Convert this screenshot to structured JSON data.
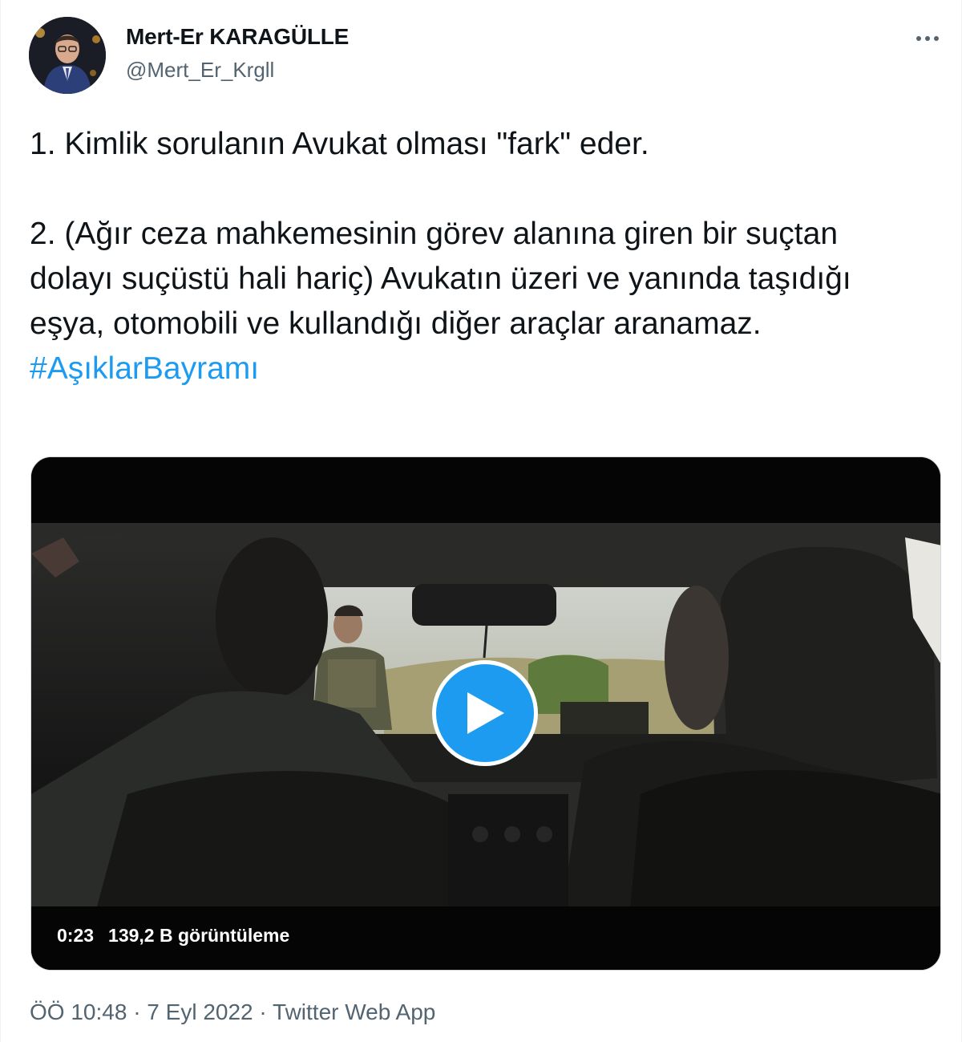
{
  "author": {
    "display_name": "Mert-Er KARAGÜLLE",
    "handle": "@Mert_Er_Krgll"
  },
  "tweet": {
    "line1": "1. Kimlik sorulanın Avukat olması \"fark\" eder.",
    "line2": "2. (Ağır ceza mahkemesinin görev alanına giren bir suçtan dolayı suçüstü hali hariç) Avukatın üzeri ve yanında taşıdığı eşya, otomobili ve kullandığı diğer araçlar aranamaz.",
    "hashtag": "#AşıklarBayramı"
  },
  "video": {
    "duration": "0:23",
    "views": "139,2 B görüntüleme"
  },
  "footer": {
    "time": "ÖÖ 10:48",
    "sep1": "·",
    "date": "7 Eyl 2022",
    "sep2": "·",
    "source": "Twitter Web App"
  },
  "colors": {
    "accent": "#1d9bf0",
    "secondary_text": "#536471",
    "primary_text": "#0f1419"
  },
  "icons": {
    "more": "more-horizontal-icon",
    "play": "play-icon"
  }
}
